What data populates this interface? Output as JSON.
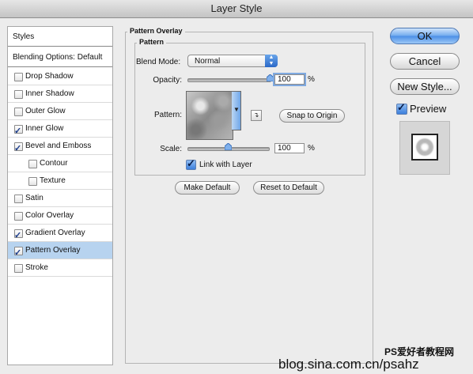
{
  "window": {
    "title": "Layer Style"
  },
  "sidebar": {
    "header": "Styles",
    "blending": "Blending Options: Default",
    "items": [
      {
        "label": "Drop Shadow",
        "checked": false,
        "indent": false,
        "selected": false
      },
      {
        "label": "Inner Shadow",
        "checked": false,
        "indent": false,
        "selected": false
      },
      {
        "label": "Outer Glow",
        "checked": false,
        "indent": false,
        "selected": false
      },
      {
        "label": "Inner Glow",
        "checked": true,
        "indent": false,
        "selected": false
      },
      {
        "label": "Bevel and Emboss",
        "checked": true,
        "indent": false,
        "selected": false
      },
      {
        "label": "Contour",
        "checked": false,
        "indent": true,
        "selected": false
      },
      {
        "label": "Texture",
        "checked": false,
        "indent": true,
        "selected": false
      },
      {
        "label": "Satin",
        "checked": false,
        "indent": false,
        "selected": false
      },
      {
        "label": "Color Overlay",
        "checked": false,
        "indent": false,
        "selected": false
      },
      {
        "label": "Gradient Overlay",
        "checked": true,
        "indent": false,
        "selected": false
      },
      {
        "label": "Pattern Overlay",
        "checked": true,
        "indent": false,
        "selected": true
      },
      {
        "label": "Stroke",
        "checked": false,
        "indent": false,
        "selected": false
      }
    ]
  },
  "panel": {
    "group_title": "Pattern Overlay",
    "section_title": "Pattern",
    "blend_mode_label": "Blend Mode:",
    "blend_mode_value": "Normal",
    "opacity_label": "Opacity:",
    "opacity_value": "100",
    "opacity_fraction": 1.0,
    "pattern_label": "Pattern:",
    "snap_button": "Snap to Origin",
    "scale_label": "Scale:",
    "scale_value": "100",
    "scale_fraction": 0.5,
    "percent": "%",
    "link_label": "Link with Layer",
    "link_checked": true,
    "make_default": "Make Default",
    "reset_default": "Reset to Default"
  },
  "actions": {
    "ok": "OK",
    "cancel": "Cancel",
    "new_style": "New Style...",
    "preview_label": "Preview",
    "preview_checked": true
  },
  "watermark": {
    "line1": "PS爱好者教程网",
    "line2": "blog.sina.com.cn/psahz"
  },
  "colors": {
    "selected_row": "#b7d3ef",
    "accent_blue": "#4a8ee6"
  }
}
